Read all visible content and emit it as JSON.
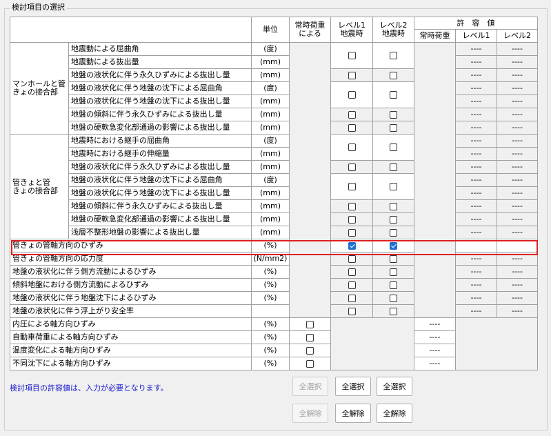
{
  "group_title": "検討項目の選択",
  "headers": {
    "unit": "単位",
    "jouji_line1": "常時荷重",
    "jouji_line2": "による",
    "lv1_line1": "レベル1",
    "lv1_line2": "地震時",
    "lv2_line1": "レベル2",
    "lv2_line2": "地震時",
    "allow": "許　容　値",
    "allow_jouji": "常時荷重",
    "allow_lv1": "レベル1",
    "allow_lv2": "レベル2"
  },
  "group_labels": {
    "g1_line1": "マンホールと管",
    "g1_line2": "きょの接合部",
    "g2_line1": "管きょと管",
    "g2_line2": "きょの接合部"
  },
  "dash": "----",
  "rows": [
    {
      "item": "地震動による屈曲角",
      "unit": "(度)"
    },
    {
      "item": "地震動による抜出量",
      "unit": "(mm)"
    },
    {
      "item": "地盤の液状化に伴う永久ひずみによる抜出し量",
      "unit": "(mm)"
    },
    {
      "item": "地盤の液状化に伴う地盤の沈下による屈曲角",
      "unit": "(度)"
    },
    {
      "item": "地盤の液状化に伴う地盤の沈下による抜出し量",
      "unit": "(mm)"
    },
    {
      "item": "地盤の傾斜に伴う永久ひずみによる抜出し量",
      "unit": "(mm)"
    },
    {
      "item": "地盤の硬軟急変化部通過の影響による抜出し量",
      "unit": "(mm)"
    },
    {
      "item": "地震時における継手の屈曲角",
      "unit": "(度)"
    },
    {
      "item": "地震時における継手の伸縮量",
      "unit": "(mm)"
    },
    {
      "item": "地盤の液状化に伴う永久ひずみによる抜出し量",
      "unit": "(mm)"
    },
    {
      "item": "地盤の液状化に伴う地盤の沈下による屈曲角",
      "unit": "(度)"
    },
    {
      "item": "地盤の液状化に伴う地盤の沈下による抜出し量",
      "unit": "(mm)"
    },
    {
      "item": "地盤の傾斜に伴う永久ひずみによる抜出し量",
      "unit": "(mm)"
    },
    {
      "item": "地盤の硬軟急変化部通過の影響による抜出し量",
      "unit": "(mm)"
    },
    {
      "item": "浅層不整形地盤の影響による抜出し量",
      "unit": "(mm)"
    },
    {
      "item": "管きょの管軸方向のひずみ",
      "unit": "(%)",
      "lv1_checked": true,
      "lv2_checked": true
    },
    {
      "item": "管きょの管軸方向の応力度",
      "unit": "(N/mm2)"
    },
    {
      "item": "地盤の液状化に伴う側方流動によるひずみ",
      "unit": "(%)"
    },
    {
      "item": "傾斜地盤における側方流動によるひずみ",
      "unit": "(%)"
    },
    {
      "item": "地盤の液状化に伴う地盤沈下によるひずみ",
      "unit": "(%)"
    },
    {
      "item": "地盤の液状化に伴う浮上がり安全率",
      "unit": ""
    },
    {
      "item": "内圧による軸方向ひずみ",
      "unit": "(%)"
    },
    {
      "item": "自動車荷重による軸方向ひずみ",
      "unit": "(%)"
    },
    {
      "item": "温度変化による軸方向ひずみ",
      "unit": "(%)"
    },
    {
      "item": "不同沈下による軸方向ひずみ",
      "unit": "(%)"
    }
  ],
  "note": "検討項目の許容値は、入力が必要となります。",
  "buttons": {
    "select_all_jouji": "全選択",
    "select_all_lv1": "全選択",
    "select_all_lv2": "全選択",
    "clear_all_jouji": "全解除",
    "clear_all_lv1": "全解除",
    "clear_all_lv2": "全解除"
  }
}
